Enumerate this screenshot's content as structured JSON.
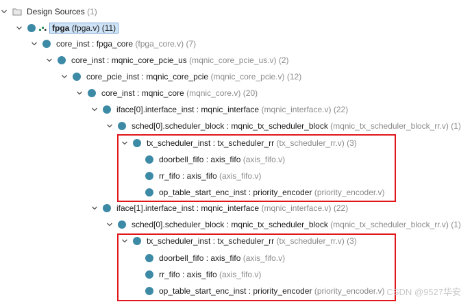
{
  "root": {
    "label": "Design Sources",
    "count": "(1)"
  },
  "rows": [
    {
      "name": "fpga",
      "file": "(fpga.v)",
      "count": "(11)",
      "top": true
    },
    {
      "name": "core_inst : fpga_core",
      "file": "(fpga_core.v)",
      "count": "(7)"
    },
    {
      "name": "core_inst : mqnic_core_pcie_us",
      "file": "(mqnic_core_pcie_us.v)",
      "count": "(2)"
    },
    {
      "name": "core_pcie_inst : mqnic_core_pcie",
      "file": "(mqnic_core_pcie.v)",
      "count": "(12)"
    },
    {
      "name": "core_inst : mqnic_core",
      "file": "(mqnic_core.v)",
      "count": "(20)"
    },
    {
      "name": "iface[0].interface_inst : mqnic_interface",
      "file": "(mqnic_interface.v)",
      "count": "(22)"
    },
    {
      "name": "sched[0].scheduler_block : mqnic_tx_scheduler_block",
      "file": "(mqnic_tx_scheduler_block_rr.v)",
      "count": "(1)"
    },
    {
      "name": "tx_scheduler_inst : tx_scheduler_rr",
      "file": "(tx_scheduler_rr.v)",
      "count": "(3)"
    },
    {
      "name": "doorbell_fifo : axis_fifo",
      "file": "(axis_fifo.v)",
      "count": ""
    },
    {
      "name": "rr_fifo : axis_fifo",
      "file": "(axis_fifo.v)",
      "count": ""
    },
    {
      "name": "op_table_start_enc_inst : priority_encoder",
      "file": "(priority_encoder.v)",
      "count": ""
    },
    {
      "name": "iface[1].interface_inst : mqnic_interface",
      "file": "(mqnic_interface.v)",
      "count": "(22)"
    },
    {
      "name": "sched[0].scheduler_block : mqnic_tx_scheduler_block",
      "file": "(mqnic_tx_scheduler_block_rr.v)",
      "count": "(1)"
    },
    {
      "name": "tx_scheduler_inst : tx_scheduler_rr",
      "file": "(tx_scheduler_rr.v)",
      "count": "(3)"
    },
    {
      "name": "doorbell_fifo : axis_fifo",
      "file": "(axis_fifo.v)",
      "count": ""
    },
    {
      "name": "rr_fifo : axis_fifo",
      "file": "(axis_fifo.v)",
      "count": ""
    },
    {
      "name": "op_table_start_enc_inst : priority_encoder",
      "file": "(priority_encoder.v)",
      "count": ""
    }
  ],
  "watermark": "CSDN @9527华安",
  "colors": {
    "node_dot": "#3d8aa6",
    "highlight_box": "#e0161b",
    "selection": "#cfe3f7"
  }
}
